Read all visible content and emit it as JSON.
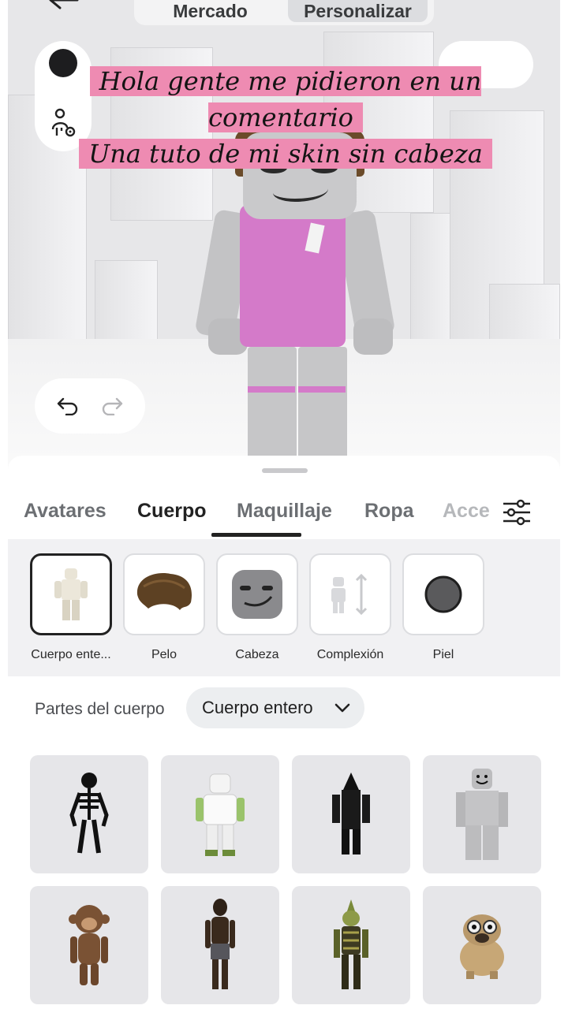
{
  "header": {
    "segments": [
      {
        "label": "Mercado",
        "active": false
      },
      {
        "label": "Personalizar",
        "active": true
      }
    ]
  },
  "caption": {
    "line1": "Hola gente me pidieron en un comentario",
    "line2": "Una tuto de mi skin sin cabeza",
    "highlight_color": "#ee8bb2"
  },
  "tabs": [
    {
      "label": "Avatares"
    },
    {
      "label": "Cuerpo",
      "selected": true
    },
    {
      "label": "Maquillaje",
      "underlined": true
    },
    {
      "label": "Ropa"
    },
    {
      "label": "Acce"
    }
  ],
  "categories": [
    {
      "label": "Cuerpo ente...",
      "icon": "full-body-thumbnail",
      "selected": true
    },
    {
      "label": "Pelo",
      "icon": "hair-thumbnail"
    },
    {
      "label": "Cabeza",
      "icon": "head-thumbnail"
    },
    {
      "label": "Complexión",
      "icon": "body-scale-icon"
    },
    {
      "label": "Piel",
      "icon": "skin-color-icon"
    }
  ],
  "body_parts": {
    "label": "Partes del cuerpo",
    "selected": "Cuerpo entero"
  },
  "items": [
    {
      "icon": "skeleton-body"
    },
    {
      "icon": "white-robot-body"
    },
    {
      "icon": "black-pencil-body"
    },
    {
      "icon": "gray-block-body"
    },
    {
      "icon": "monkey-body"
    },
    {
      "icon": "human-shorts-body"
    },
    {
      "icon": "goblin-body"
    },
    {
      "icon": "pug-body"
    }
  ],
  "colors": {
    "accent": "#222222",
    "shirt": "#d47ac9",
    "sheet_bg": "#f1f1f3"
  }
}
